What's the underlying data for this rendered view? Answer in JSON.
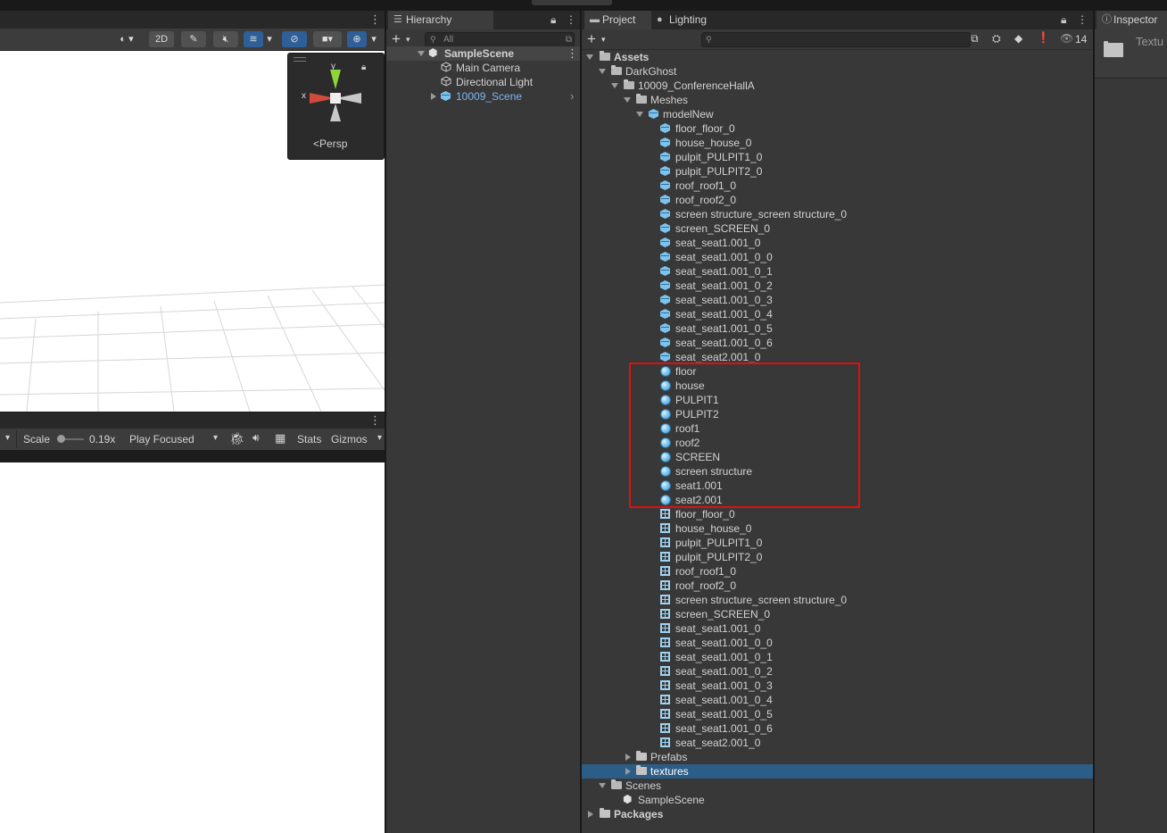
{
  "scene": {
    "toolbar_2d": "2D",
    "gizmo_label": "Persp",
    "axis_x": "x",
    "axis_y": "y"
  },
  "game": {
    "scale_label": "Scale",
    "scale_value": "0.19x",
    "play_mode": "Play Focused",
    "stats": "Stats",
    "gizmos": "Gizmos"
  },
  "hierarchy": {
    "tab": "Hierarchy",
    "search_placeholder": "All",
    "scene": "SampleScene",
    "items": [
      "Main Camera",
      "Directional Light",
      "10009_Scene"
    ]
  },
  "project": {
    "tab": "Project",
    "lighting_tab": "Lighting",
    "hidden_count": "14",
    "root": "Assets",
    "darkghost": "DarkGhost",
    "conference": "10009_ConferenceHallA",
    "meshes": "Meshes",
    "model": "modelNew",
    "mesh_items": [
      "floor_floor_0",
      "house_house_0",
      "pulpit_PULPIT1_0",
      "pulpit_PULPIT2_0",
      "roof_roof1_0",
      "roof_roof2_0",
      "screen structure_screen structure_0",
      "screen_SCREEN_0",
      "seat_seat1.001_0",
      "seat_seat1.001_0_0",
      "seat_seat1.001_0_1",
      "seat_seat1.001_0_2",
      "seat_seat1.001_0_3",
      "seat_seat1.001_0_4",
      "seat_seat1.001_0_5",
      "seat_seat1.001_0_6",
      "seat_seat2.001_0"
    ],
    "material_items": [
      "floor",
      "house",
      "PULPIT1",
      "PULPIT2",
      "roof1",
      "roof2",
      "SCREEN",
      "screen structure",
      "seat1.001",
      "seat2.001"
    ],
    "grid_items": [
      "floor_floor_0",
      "house_house_0",
      "pulpit_PULPIT1_0",
      "pulpit_PULPIT2_0",
      "roof_roof1_0",
      "roof_roof2_0",
      "screen structure_screen structure_0",
      "screen_SCREEN_0",
      "seat_seat1.001_0",
      "seat_seat1.001_0_0",
      "seat_seat1.001_0_1",
      "seat_seat1.001_0_2",
      "seat_seat1.001_0_3",
      "seat_seat1.001_0_4",
      "seat_seat1.001_0_5",
      "seat_seat1.001_0_6",
      "seat_seat2.001_0"
    ],
    "prefabs": "Prefabs",
    "textures": "textures",
    "scenes": "Scenes",
    "sample_scene": "SampleScene",
    "packages": "Packages"
  },
  "inspector": {
    "tab": "Inspector",
    "title": "Textu"
  },
  "colors": {
    "selection": "#2c5d87",
    "highlight_box": "#e0100f",
    "asset_icon": "#7cc4ee"
  }
}
